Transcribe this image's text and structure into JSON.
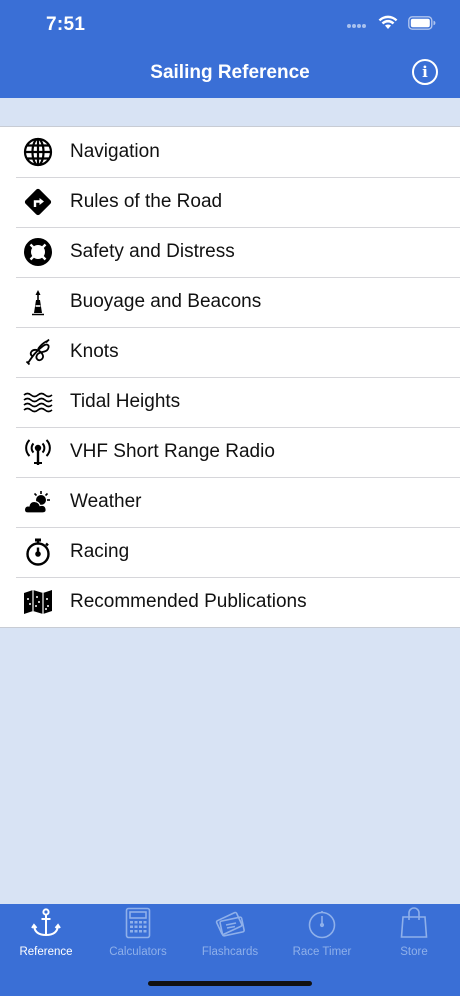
{
  "status": {
    "time": "7:51"
  },
  "header": {
    "title": "Sailing Reference"
  },
  "menu": [
    {
      "label": "Navigation",
      "icon": "globe-icon"
    },
    {
      "label": "Rules of the Road",
      "icon": "diamond-arrow-icon"
    },
    {
      "label": "Safety and Distress",
      "icon": "lifebuoy-icon"
    },
    {
      "label": "Buoyage and Beacons",
      "icon": "buoy-icon"
    },
    {
      "label": "Knots",
      "icon": "knot-icon"
    },
    {
      "label": "Tidal Heights",
      "icon": "waves-icon"
    },
    {
      "label": "VHF Short Range Radio",
      "icon": "radio-antenna-icon"
    },
    {
      "label": "Weather",
      "icon": "sun-cloud-icon"
    },
    {
      "label": "Racing",
      "icon": "stopwatch-icon"
    },
    {
      "label": "Recommended Publications",
      "icon": "map-icon"
    }
  ],
  "tabs": [
    {
      "label": "Reference",
      "icon": "anchor-icon",
      "active": true
    },
    {
      "label": "Calculators",
      "icon": "calculator-icon",
      "active": false
    },
    {
      "label": "Flashcards",
      "icon": "flashcards-icon",
      "active": false
    },
    {
      "label": "Race Timer",
      "icon": "timer-icon",
      "active": false
    },
    {
      "label": "Store",
      "icon": "shopping-bag-icon",
      "active": false
    }
  ],
  "colors": {
    "accent": "#3a6fd6",
    "background": "#d8e3f4",
    "tab_inactive": "#8fb0ea"
  }
}
